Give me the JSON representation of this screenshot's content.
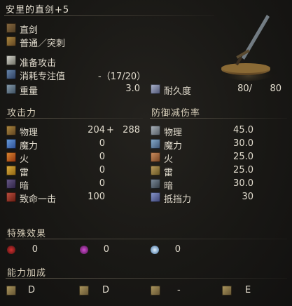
{
  "title": "安里的直剑+5",
  "weapon_info": {
    "category": "直剑",
    "attack_type": "普通／突刺",
    "skill": "准备攻击",
    "fp_label": "消耗专注值",
    "fp_value": "-（17/20）",
    "weight_label": "重量",
    "weight_value": "3.0",
    "durability_label": "耐久度",
    "durability_current": "80/",
    "durability_max": "80"
  },
  "attack": {
    "header": "攻击力",
    "rows": [
      {
        "label": "物理",
        "value": "204",
        "plus": "+",
        "bonus": "288"
      },
      {
        "label": "魔力",
        "value": "0"
      },
      {
        "label": "火",
        "value": "0"
      },
      {
        "label": "雷",
        "value": "0"
      },
      {
        "label": "暗",
        "value": "0"
      },
      {
        "label": "致命一击",
        "value": "100"
      }
    ]
  },
  "defense": {
    "header": "防御减伤率",
    "rows": [
      {
        "label": "物理",
        "value": "45.0"
      },
      {
        "label": "魔力",
        "value": "30.0"
      },
      {
        "label": "火",
        "value": "25.0"
      },
      {
        "label": "雷",
        "value": "25.0"
      },
      {
        "label": "暗",
        "value": "30.0"
      },
      {
        "label": "抵挡力",
        "value": "30"
      }
    ]
  },
  "special": {
    "header": "特殊效果",
    "items": [
      {
        "value": "0",
        "icon": "bleed-icon"
      },
      {
        "value": "0",
        "icon": "poison-icon"
      },
      {
        "value": "0",
        "icon": "frost-icon"
      }
    ]
  },
  "scaling": {
    "header": "能力加成",
    "items": [
      {
        "value": "D",
        "icon": "strength-icon"
      },
      {
        "value": "D",
        "icon": "dexterity-icon"
      },
      {
        "value": "-",
        "icon": "intelligence-icon"
      },
      {
        "value": "E",
        "icon": "faith-icon"
      }
    ]
  },
  "colors": {
    "background": "#151412",
    "text": "#e1dbcd",
    "accent": "#c9b98a"
  }
}
